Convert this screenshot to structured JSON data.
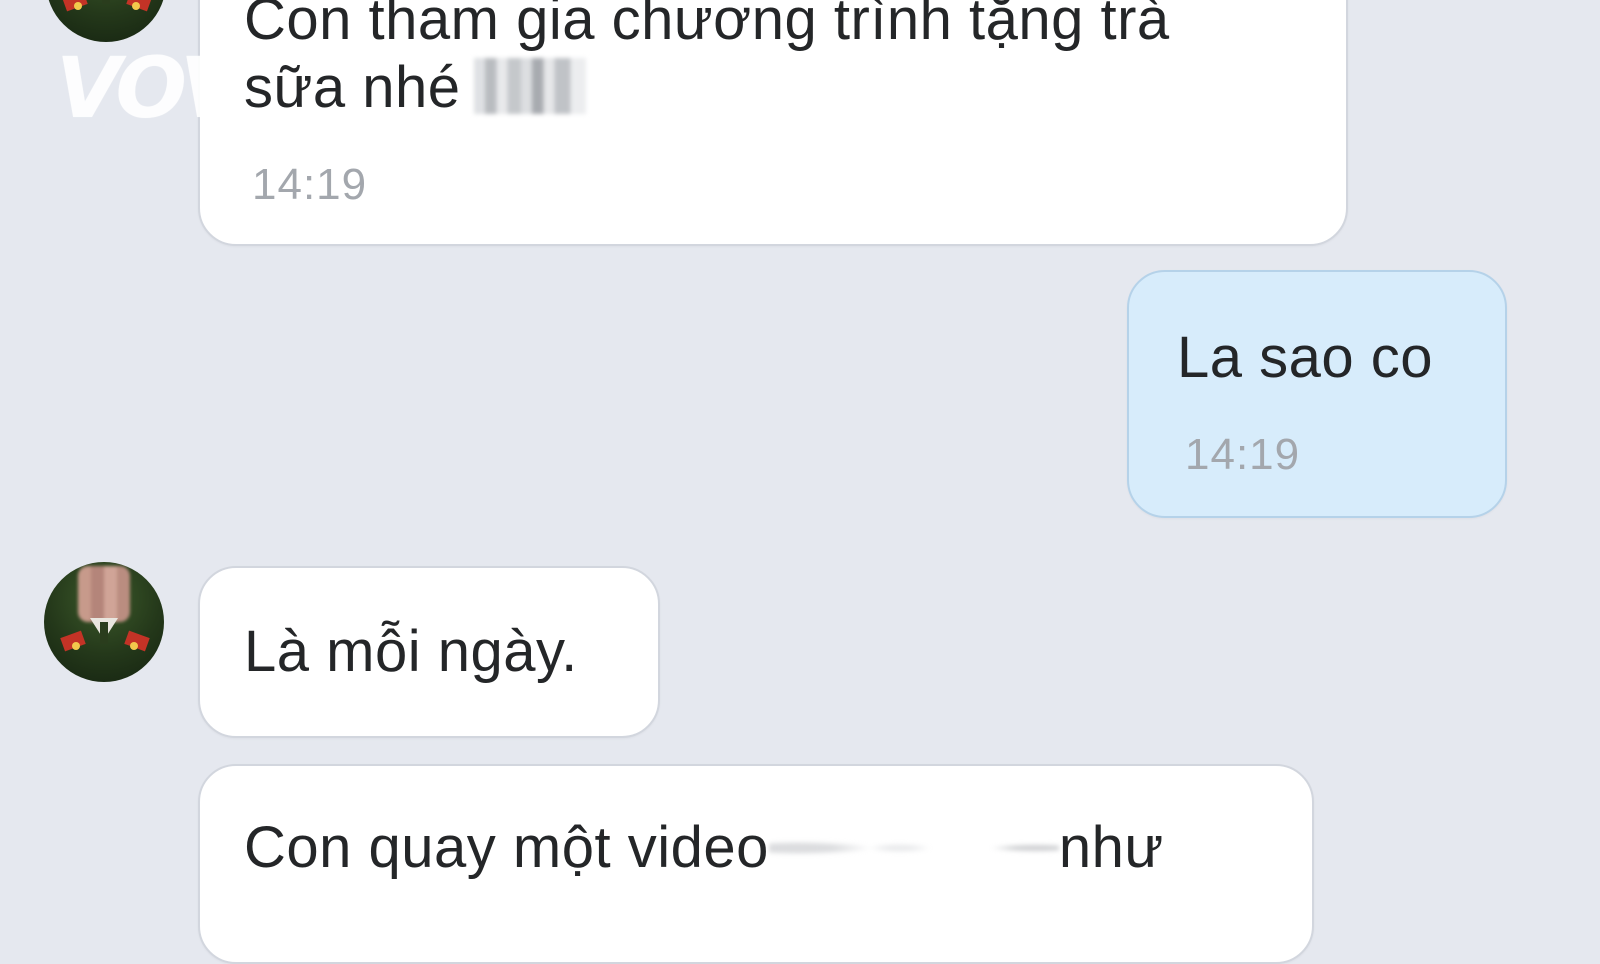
{
  "watermark": "VOV",
  "messages": [
    {
      "direction": "incoming",
      "line1": "Con tham gia chương trình tặng trà",
      "line2": "sữa nhé",
      "time": "14:19"
    },
    {
      "direction": "outgoing",
      "text": "La sao co",
      "time": "14:19"
    },
    {
      "direction": "incoming",
      "text": "Là mỗi ngày."
    },
    {
      "direction": "incoming",
      "text_before": "Con quay một video",
      "text_after": "như"
    }
  ],
  "colors": {
    "background": "#e5e8ef",
    "incoming_bubble": "#ffffff",
    "outgoing_bubble": "#d7ecfb",
    "timestamp": "#a3a7ad"
  }
}
